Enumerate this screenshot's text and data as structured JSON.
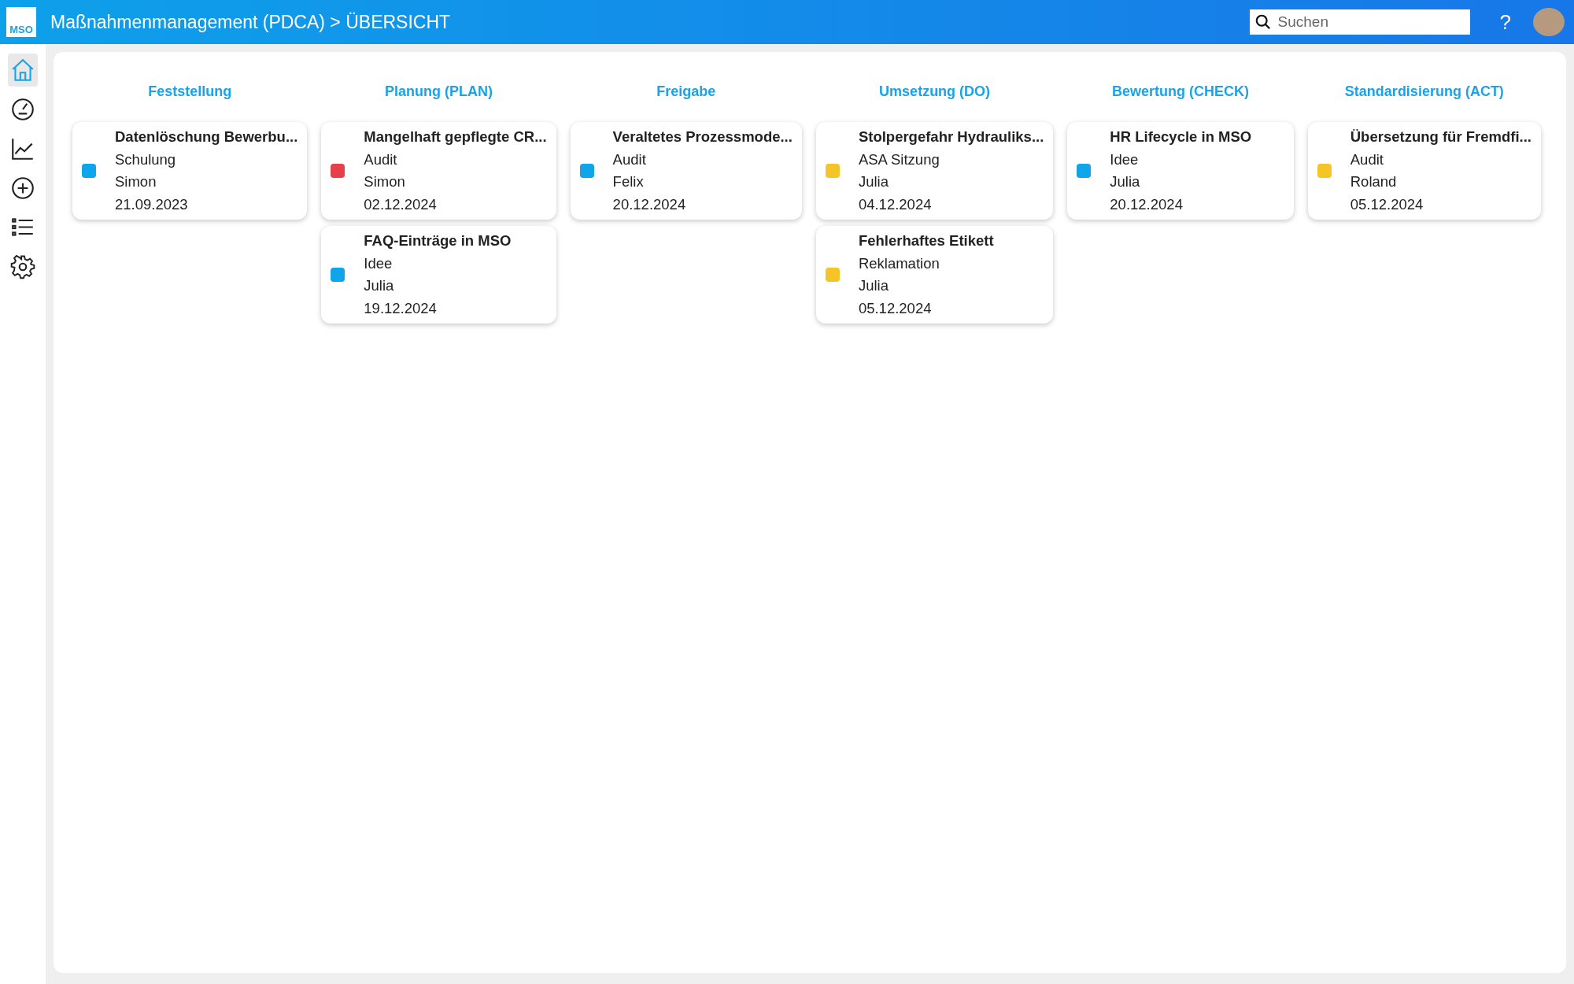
{
  "header": {
    "logo": "MSO",
    "title": "Maßnahmenmanagement (PDCA) > ÜBERSICHT",
    "search": {
      "placeholder": "Suchen"
    },
    "help": "?"
  },
  "sidebar": {
    "items": [
      {
        "kind": "home",
        "selected": true
      },
      {
        "kind": "gauge",
        "selected": false
      },
      {
        "kind": "chart",
        "selected": false
      },
      {
        "kind": "plus",
        "selected": false
      },
      {
        "kind": "list",
        "selected": false
      },
      {
        "kind": "gear",
        "selected": false
      }
    ]
  },
  "columns": [
    {
      "title": "Feststellung",
      "cards": [
        {
          "title": "Datenlöschung Bewerbu...",
          "category": "Schulung",
          "person": "Simon",
          "date": "21.09.2023",
          "color": "#0ea5ea"
        }
      ]
    },
    {
      "title": "Planung (PLAN)",
      "cards": [
        {
          "title": "Mangelhaft gepflegte CR...",
          "category": "Audit",
          "person": "Simon",
          "date": "02.12.2024",
          "color": "#e8404a"
        },
        {
          "title": "FAQ-Einträge in MSO",
          "category": "Idee",
          "person": "Julia",
          "date": "19.12.2024",
          "color": "#0ea5ea"
        }
      ]
    },
    {
      "title": "Freigabe",
      "cards": [
        {
          "title": "Veraltetes Prozessmode...",
          "category": "Audit",
          "person": "Felix",
          "date": "20.12.2024",
          "color": "#0ea5ea"
        }
      ]
    },
    {
      "title": "Umsetzung (DO)",
      "cards": [
        {
          "title": "Stolpergefahr Hydrauliks...",
          "category": "ASA Sitzung",
          "person": "Julia",
          "date": "04.12.2024",
          "color": "#f5c528"
        },
        {
          "title": "Fehlerhaftes Etikett",
          "category": "Reklamation",
          "person": "Julia",
          "date": "05.12.2024",
          "color": "#f5c528"
        }
      ]
    },
    {
      "title": "Bewertung (CHECK)",
      "cards": [
        {
          "title": "HR Lifecycle in MSO",
          "category": "Idee",
          "person": "Julia",
          "date": "20.12.2024",
          "color": "#0ea5ea"
        }
      ]
    },
    {
      "title": "Standardisierung (ACT)",
      "cards": [
        {
          "title": "Übersetzung für Fremdfi...",
          "category": "Audit",
          "person": "Roland",
          "date": "05.12.2024",
          "color": "#f5c528"
        }
      ]
    }
  ]
}
